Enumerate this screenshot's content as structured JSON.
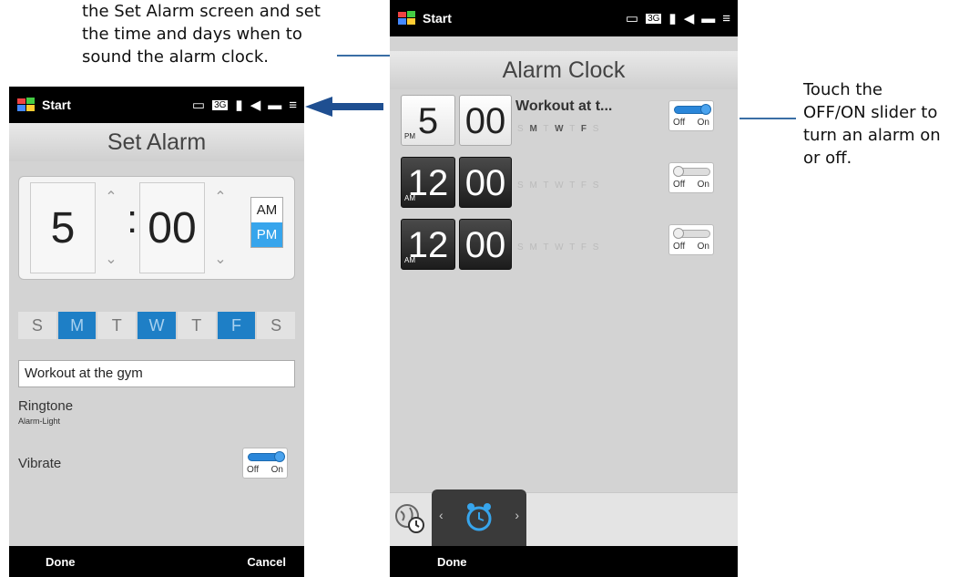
{
  "callouts": {
    "left_lines": [
      "the Set Alarm screen and set",
      "the time and days when to",
      "sound the alarm clock."
    ],
    "right_lines": [
      "Touch the",
      "OFF/ON slider to",
      "turn an alarm on",
      "or off."
    ]
  },
  "status": {
    "start_label": "Start",
    "network_badge": "3G"
  },
  "set_alarm": {
    "title": "Set Alarm",
    "hour": "5",
    "colon": ":",
    "minute": "00",
    "am": "AM",
    "pm": "PM",
    "days": [
      {
        "label": "S",
        "selected": false
      },
      {
        "label": "M",
        "selected": true
      },
      {
        "label": "T",
        "selected": false
      },
      {
        "label": "W",
        "selected": true
      },
      {
        "label": "T",
        "selected": false
      },
      {
        "label": "F",
        "selected": true
      },
      {
        "label": "S",
        "selected": false
      }
    ],
    "description": "Workout at the gym",
    "ringtone_label": "Ringtone",
    "ringtone_value": "Alarm-Light",
    "vibrate_label": "Vibrate",
    "vibrate_on": true,
    "done": "Done",
    "cancel": "Cancel"
  },
  "alarm_clock": {
    "title": "Alarm Clock",
    "alarms": [
      {
        "hour": "5",
        "minute": "00",
        "period": "PM",
        "name": "Workout at t...",
        "days": [
          "S",
          "M",
          "T",
          "W",
          "T",
          "F",
          "S"
        ],
        "on": true
      },
      {
        "hour": "12",
        "minute": "00",
        "period": "AM",
        "name": "",
        "days": [
          "S",
          "M",
          "T",
          "W",
          "T",
          "F",
          "S"
        ],
        "on": false
      },
      {
        "hour": "12",
        "minute": "00",
        "period": "AM",
        "name": "",
        "days": [
          "S",
          "M",
          "T",
          "W",
          "T",
          "F",
          "S"
        ],
        "on": false
      }
    ],
    "toggle_off": "Off",
    "toggle_on": "On",
    "done": "Done"
  },
  "colors": {
    "accent": "#1e7fc6",
    "arrow": "#1f4f91",
    "callout_line": "#3a6ea5"
  },
  "icons": [
    "windows-logo-icon",
    "tv-icon",
    "signal-icon",
    "speaker-icon",
    "battery-icon",
    "menu-icon",
    "world-clock-icon",
    "alarm-clock-icon",
    "left-arrow-icon"
  ]
}
